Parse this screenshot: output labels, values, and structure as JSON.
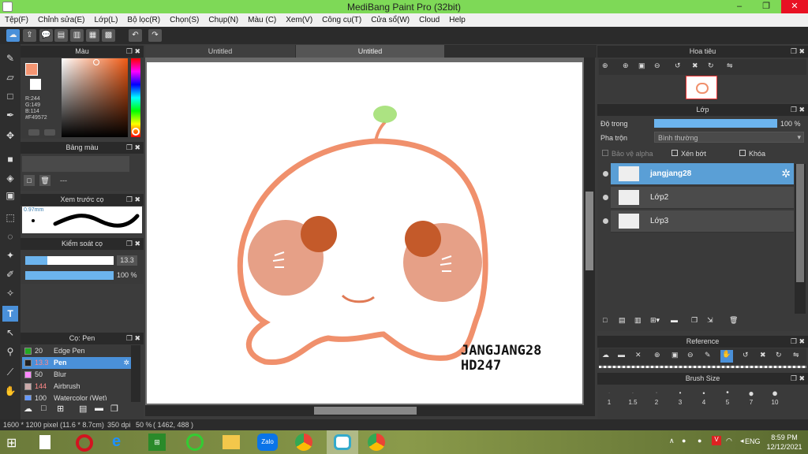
{
  "app": {
    "title": "MediBang Paint Pro (32bit)",
    "win_min": "–",
    "win_max": "❐",
    "win_close": "✕"
  },
  "menu": [
    "Tệp(F)",
    "Chỉnh sửa(E)",
    "Lớp(L)",
    "Bộ lọc(R)",
    "Chọn(S)",
    "Chụp(N)",
    "Màu (C)",
    "Xem(V)",
    "Công cụ(T)",
    "Cửa sổ(W)",
    "Cloud",
    "Help"
  ],
  "tabs": [
    "Untitled",
    "Untitled"
  ],
  "color_panel": {
    "title": "Màu",
    "r": "R:244",
    "g": "G:149",
    "b": "B:114",
    "hex": "#F49572",
    "fg": "#F49572"
  },
  "palette_panel": {
    "title": "Bảng màu",
    "dash": "---"
  },
  "brush_preview": {
    "title": "Xem trước cọ",
    "size": "0.97mm"
  },
  "brush_control": {
    "title": "Kiểm soát cọ",
    "size": "13.3",
    "opacity": "100 %",
    "size_fraction": 0.25,
    "opacity_fraction": 1.0
  },
  "brush_list": {
    "title": "Cọ: Pen",
    "items": [
      {
        "size": "20",
        "name": "Edge Pen",
        "color": "#22aa22"
      },
      {
        "size": "13.3",
        "name": "Pen",
        "color": "#222222"
      },
      {
        "size": "50",
        "name": "Blur",
        "color": "#ff88ff"
      },
      {
        "size": "144",
        "name": "Airbrush",
        "color": "#ccaaaa"
      },
      {
        "size": "100",
        "name": "Watercolor (Wet)",
        "color": "#6699ff"
      }
    ]
  },
  "canvas_text": {
    "line1": "JANGJANG28",
    "line2": "HD247"
  },
  "navigator": {
    "title": "Hoa tiêu"
  },
  "layers": {
    "title": "Lớp",
    "opacity_label": "Độ trong",
    "opacity_value": "100 %",
    "opacity_fraction": 1.0,
    "blend_label": "Pha trộn",
    "blend_value": "Bình thường",
    "protect_alpha": "Bảo vệ alpha",
    "clip": "Xén bớt",
    "lock": "Khóa",
    "items": [
      "jangjang28",
      "Lớp2",
      "Lớp3"
    ]
  },
  "reference": {
    "title": "Reference"
  },
  "brush_size": {
    "title": "Brush Size",
    "sizes": [
      "1",
      "1.5",
      "2",
      "3",
      "4",
      "5",
      "7",
      "10"
    ]
  },
  "status": {
    "dims": "1600 * 1200 pixel",
    "cm": "(11.6 * 8.7cm)",
    "dpi": "350 dpi",
    "zoom": "50 %",
    "coords": "( 1462, 488 )"
  },
  "taskbar": {
    "lang": "ENG",
    "time": "8:59 PM",
    "date": "12/12/2021"
  }
}
